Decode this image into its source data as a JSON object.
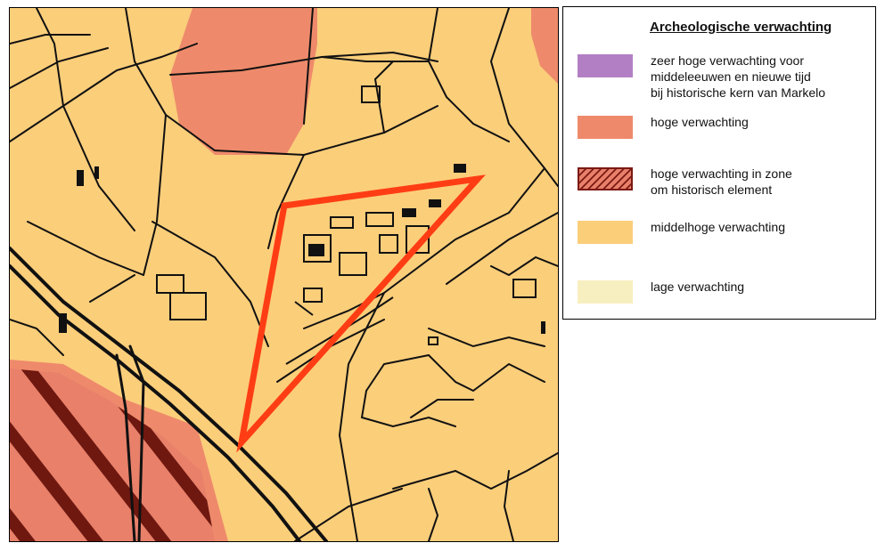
{
  "legend": {
    "title": "Archeologische verwachting",
    "items": [
      {
        "id": "zeer-hoog",
        "label": "zeer hoge verwachting voor\nmiddeleeuwen en nieuwe tijd\nbij historische kern van Markelo",
        "color": "#b37fc4",
        "pattern": "solid"
      },
      {
        "id": "hoog",
        "label": "hoge verwachting",
        "color": "#ee8a6b",
        "pattern": "solid"
      },
      {
        "id": "hoog-zone",
        "label": "hoge verwachting in zone\nom historisch element",
        "color": "#e8806a",
        "pattern": "hatched"
      },
      {
        "id": "middelhoog",
        "label": "middelhoge verwachting",
        "color": "#fbce7a",
        "pattern": "solid"
      },
      {
        "id": "laag",
        "label": "lage verwachting",
        "color": "#f8efc0",
        "pattern": "solid"
      }
    ]
  },
  "map": {
    "base_color": "#fbce7a",
    "high_color": "#ee8a6b",
    "hatch_color": "#7a1a14",
    "line_color": "#111111",
    "plan_area_color": "#ff3d14"
  }
}
